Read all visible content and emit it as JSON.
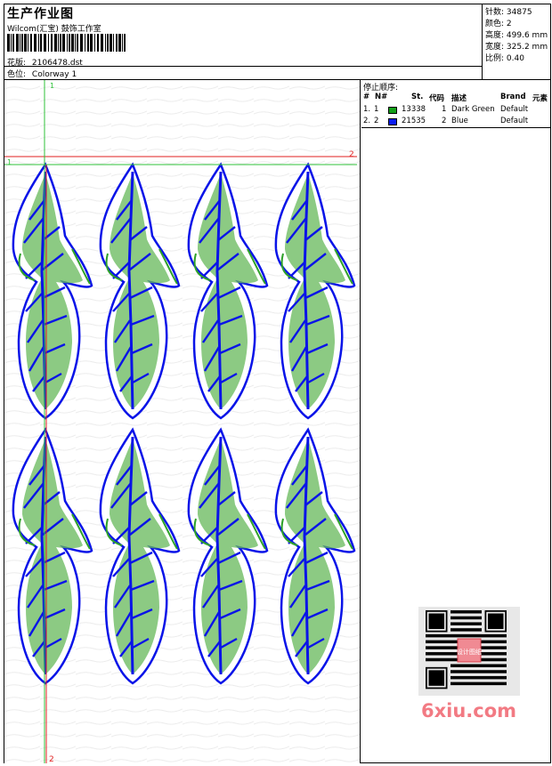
{
  "header": {
    "title": "生产作业图",
    "company": "Wilcom(汇宝) 鼓饰工作室",
    "design_label": "花版:",
    "design_value": "2106478.dst",
    "colorway_label": "色位:",
    "colorway_value": "Colorway 1"
  },
  "stats": {
    "stitches_label": "针数:",
    "stitches_value": "34875",
    "colors_label": "颜色:",
    "colors_value": "2",
    "height_label": "高度:",
    "height_value": "499.6 mm",
    "width_label": "宽度:",
    "width_value": "325.2 mm",
    "scale_label": "比例:",
    "scale_value": "0.40"
  },
  "stop_sequence": {
    "title": "停止顺序:",
    "columns": [
      "#",
      "N#",
      "St.",
      "代码",
      "描述",
      "Brand",
      "元素"
    ],
    "rows": [
      {
        "index": "1.",
        "n": "1",
        "color": "#13a019",
        "stitches": "13338",
        "code": "1",
        "desc": "Dark Green",
        "brand": "Default"
      },
      {
        "index": "2.",
        "n": "2",
        "color": "#0a1cf0",
        "stitches": "21535",
        "code": "2",
        "desc": "Blue",
        "brand": "Default"
      }
    ]
  },
  "canvas": {
    "markers": {
      "vertical_top": "1",
      "vertical_bottom": "2",
      "horizontal_left": "1",
      "horizontal_right": "2"
    },
    "thread_colors": {
      "green": "#2fa12a",
      "blue": "#0a14e8",
      "guide_red": "#e01f1f",
      "guide_green": "#2fc23a"
    }
  },
  "watermark": {
    "text": "6xiu.com",
    "stamp": "设计图纸"
  }
}
